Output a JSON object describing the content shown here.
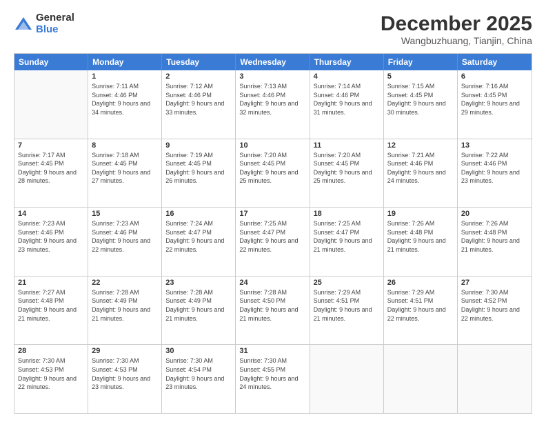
{
  "logo": {
    "general": "General",
    "blue": "Blue"
  },
  "title": "December 2025",
  "location": "Wangbuzhuang, Tianjin, China",
  "days_of_week": [
    "Sunday",
    "Monday",
    "Tuesday",
    "Wednesday",
    "Thursday",
    "Friday",
    "Saturday"
  ],
  "weeks": [
    [
      {
        "day": "",
        "empty": true
      },
      {
        "day": "1",
        "sunrise": "7:11 AM",
        "sunset": "4:46 PM",
        "daylight": "9 hours and 34 minutes."
      },
      {
        "day": "2",
        "sunrise": "7:12 AM",
        "sunset": "4:46 PM",
        "daylight": "9 hours and 33 minutes."
      },
      {
        "day": "3",
        "sunrise": "7:13 AM",
        "sunset": "4:46 PM",
        "daylight": "9 hours and 32 minutes."
      },
      {
        "day": "4",
        "sunrise": "7:14 AM",
        "sunset": "4:46 PM",
        "daylight": "9 hours and 31 minutes."
      },
      {
        "day": "5",
        "sunrise": "7:15 AM",
        "sunset": "4:45 PM",
        "daylight": "9 hours and 30 minutes."
      },
      {
        "day": "6",
        "sunrise": "7:16 AM",
        "sunset": "4:45 PM",
        "daylight": "9 hours and 29 minutes."
      }
    ],
    [
      {
        "day": "7",
        "sunrise": "7:17 AM",
        "sunset": "4:45 PM",
        "daylight": "9 hours and 28 minutes."
      },
      {
        "day": "8",
        "sunrise": "7:18 AM",
        "sunset": "4:45 PM",
        "daylight": "9 hours and 27 minutes."
      },
      {
        "day": "9",
        "sunrise": "7:19 AM",
        "sunset": "4:45 PM",
        "daylight": "9 hours and 26 minutes."
      },
      {
        "day": "10",
        "sunrise": "7:20 AM",
        "sunset": "4:45 PM",
        "daylight": "9 hours and 25 minutes."
      },
      {
        "day": "11",
        "sunrise": "7:20 AM",
        "sunset": "4:45 PM",
        "daylight": "9 hours and 25 minutes."
      },
      {
        "day": "12",
        "sunrise": "7:21 AM",
        "sunset": "4:46 PM",
        "daylight": "9 hours and 24 minutes."
      },
      {
        "day": "13",
        "sunrise": "7:22 AM",
        "sunset": "4:46 PM",
        "daylight": "9 hours and 23 minutes."
      }
    ],
    [
      {
        "day": "14",
        "sunrise": "7:23 AM",
        "sunset": "4:46 PM",
        "daylight": "9 hours and 23 minutes."
      },
      {
        "day": "15",
        "sunrise": "7:23 AM",
        "sunset": "4:46 PM",
        "daylight": "9 hours and 22 minutes."
      },
      {
        "day": "16",
        "sunrise": "7:24 AM",
        "sunset": "4:47 PM",
        "daylight": "9 hours and 22 minutes."
      },
      {
        "day": "17",
        "sunrise": "7:25 AM",
        "sunset": "4:47 PM",
        "daylight": "9 hours and 22 minutes."
      },
      {
        "day": "18",
        "sunrise": "7:25 AM",
        "sunset": "4:47 PM",
        "daylight": "9 hours and 21 minutes."
      },
      {
        "day": "19",
        "sunrise": "7:26 AM",
        "sunset": "4:48 PM",
        "daylight": "9 hours and 21 minutes."
      },
      {
        "day": "20",
        "sunrise": "7:26 AM",
        "sunset": "4:48 PM",
        "daylight": "9 hours and 21 minutes."
      }
    ],
    [
      {
        "day": "21",
        "sunrise": "7:27 AM",
        "sunset": "4:48 PM",
        "daylight": "9 hours and 21 minutes."
      },
      {
        "day": "22",
        "sunrise": "7:28 AM",
        "sunset": "4:49 PM",
        "daylight": "9 hours and 21 minutes."
      },
      {
        "day": "23",
        "sunrise": "7:28 AM",
        "sunset": "4:49 PM",
        "daylight": "9 hours and 21 minutes."
      },
      {
        "day": "24",
        "sunrise": "7:28 AM",
        "sunset": "4:50 PM",
        "daylight": "9 hours and 21 minutes."
      },
      {
        "day": "25",
        "sunrise": "7:29 AM",
        "sunset": "4:51 PM",
        "daylight": "9 hours and 21 minutes."
      },
      {
        "day": "26",
        "sunrise": "7:29 AM",
        "sunset": "4:51 PM",
        "daylight": "9 hours and 22 minutes."
      },
      {
        "day": "27",
        "sunrise": "7:30 AM",
        "sunset": "4:52 PM",
        "daylight": "9 hours and 22 minutes."
      }
    ],
    [
      {
        "day": "28",
        "sunrise": "7:30 AM",
        "sunset": "4:53 PM",
        "daylight": "9 hours and 22 minutes."
      },
      {
        "day": "29",
        "sunrise": "7:30 AM",
        "sunset": "4:53 PM",
        "daylight": "9 hours and 23 minutes."
      },
      {
        "day": "30",
        "sunrise": "7:30 AM",
        "sunset": "4:54 PM",
        "daylight": "9 hours and 23 minutes."
      },
      {
        "day": "31",
        "sunrise": "7:30 AM",
        "sunset": "4:55 PM",
        "daylight": "9 hours and 24 minutes."
      },
      {
        "day": "",
        "empty": true
      },
      {
        "day": "",
        "empty": true
      },
      {
        "day": "",
        "empty": true
      }
    ]
  ],
  "labels": {
    "sunrise": "Sunrise:",
    "sunset": "Sunset:",
    "daylight": "Daylight:"
  }
}
